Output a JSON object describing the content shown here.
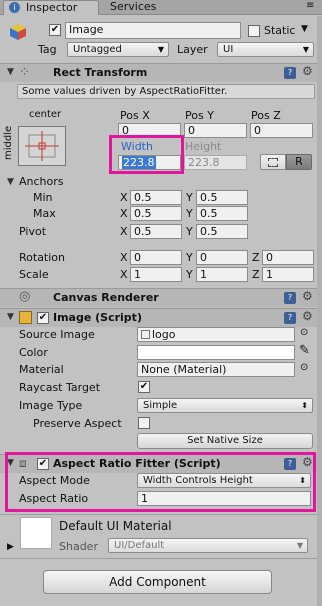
{
  "tabs": {
    "inspector": "Inspector",
    "services": "Services"
  },
  "object": {
    "name": "Image",
    "static_label": "Static",
    "tag_label": "Tag",
    "tag_value": "Untagged",
    "layer_label": "Layer",
    "layer_value": "UI"
  },
  "rect_transform": {
    "title": "Rect Transform",
    "info": "Some values driven by AspectRatioFitter.",
    "anchor_h": "center",
    "anchor_v": "middle",
    "pos_x_label": "Pos X",
    "pos_y_label": "Pos Y",
    "pos_z_label": "Pos Z",
    "pos_x": "0",
    "pos_y": "0",
    "pos_z": "0",
    "width_label": "Width",
    "height_label": "Height",
    "width": "223.8",
    "height": "223.8",
    "r_button": "R",
    "anchors_label": "Anchors",
    "min_label": "Min",
    "max_label": "Max",
    "pivot_label": "Pivot",
    "min_x": "0.5",
    "min_y": "0.5",
    "max_x": "0.5",
    "max_y": "0.5",
    "pivot_x": "0.5",
    "pivot_y": "0.5",
    "rotation_label": "Rotation",
    "scale_label": "Scale",
    "rot_x": "0",
    "rot_y": "0",
    "rot_z": "0",
    "scale_x": "1",
    "scale_y": "1",
    "scale_z": "1",
    "x": "X",
    "y": "Y",
    "z": "Z"
  },
  "canvas_renderer": {
    "title": "Canvas Renderer"
  },
  "image_script": {
    "title": "Image (Script)",
    "source_label": "Source Image",
    "source_value": "logo",
    "color_label": "Color",
    "material_label": "Material",
    "material_value": "None (Material)",
    "raycast_label": "Raycast Target",
    "image_type_label": "Image Type",
    "image_type_value": "Simple",
    "preserve_label": "Preserve Aspect",
    "native_size_button": "Set Native Size"
  },
  "aspect_fitter": {
    "title": "Aspect Ratio Fitter (Script)",
    "mode_label": "Aspect Mode",
    "mode_value": "Width Controls Height",
    "ratio_label": "Aspect Ratio",
    "ratio_value": "1"
  },
  "material": {
    "title": "Default UI Material",
    "shader_label": "Shader",
    "shader_value": "UI/Default"
  },
  "add_component": "Add Component",
  "colors": {
    "highlight": "#e0169c",
    "selection": "#3d79d6",
    "panel": "#c2c2c2"
  }
}
